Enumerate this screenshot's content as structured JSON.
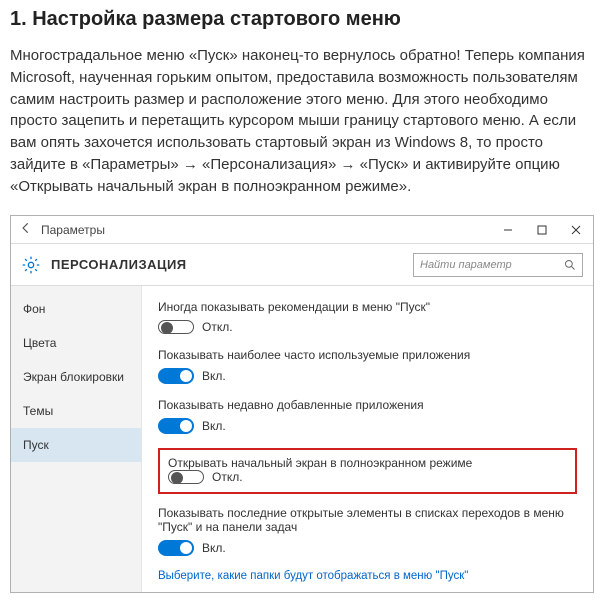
{
  "article": {
    "heading": "1. Настройка размера стартового меню",
    "body": "Многострадальное меню «Пуск» наконец-то вернулось обратно! Теперь компания Microsoft, наученная горьким опытом, предоставила возможность пользователям самим настроить размер и расположение этого меню. Для этого необходимо просто зацепить и перетащить курсором мыши границу стартового меню. А если вам опять захочется использовать стартовый экран из Windows 8, то просто зайдите в «Параметры» → «Персонализация» → «Пуск» и активируйте опцию «Открывать начальный экран в полноэкранном режиме»."
  },
  "window": {
    "titlebar": "Параметры",
    "header": "ПЕРСОНАЛИЗАЦИЯ",
    "search_placeholder": "Найти параметр"
  },
  "sidebar": {
    "items": [
      {
        "label": "Фон"
      },
      {
        "label": "Цвета"
      },
      {
        "label": "Экран блокировки"
      },
      {
        "label": "Темы"
      },
      {
        "label": "Пуск"
      }
    ],
    "active_index": 4
  },
  "settings": [
    {
      "label": "Иногда показывать рекомендации в меню \"Пуск\"",
      "on": false,
      "state_text": "Откл."
    },
    {
      "label": "Показывать наиболее часто используемые приложения",
      "on": true,
      "state_text": "Вкл."
    },
    {
      "label": "Показывать недавно добавленные приложения",
      "on": true,
      "state_text": "Вкл."
    },
    {
      "label": "Открывать начальный экран в полноэкранном режиме",
      "on": false,
      "state_text": "Откл.",
      "highlighted": true
    },
    {
      "label": "Показывать последние открытые элементы в списках переходов в меню \"Пуск\" и на панели задач",
      "on": true,
      "state_text": "Вкл."
    }
  ],
  "link": "Выберите, какие папки будут отображаться в меню \"Пуск\""
}
